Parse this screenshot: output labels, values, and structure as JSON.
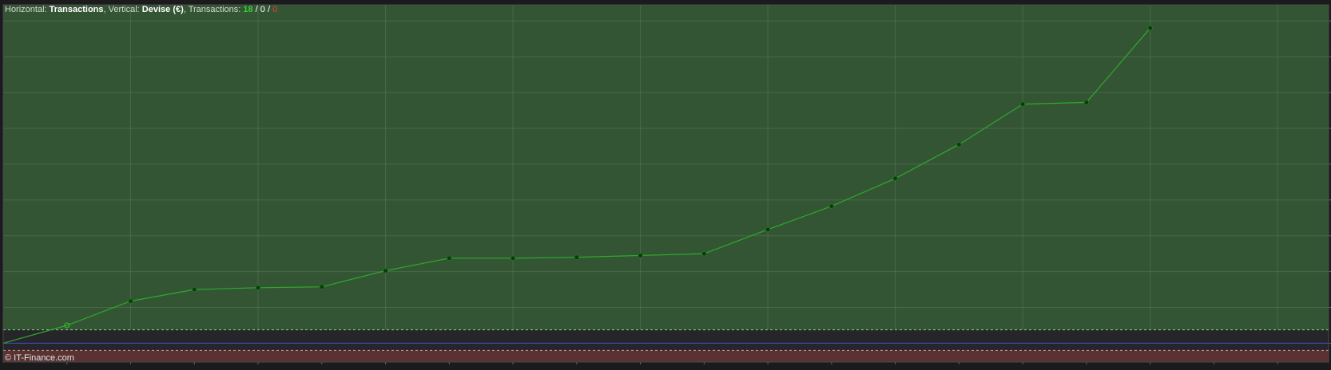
{
  "header": {
    "h_label": "Horizontal: ",
    "h_value": "Transactions",
    "v_label": ", Vertical: ",
    "v_value": "Devise (€)",
    "t_label": ", Transactions: ",
    "t_count_green": "18",
    "t_sep1": " / ",
    "t_count_white": "0",
    "t_sep2": " / ",
    "t_count_red": "0"
  },
  "footer": {
    "copyright": "© IT-Finance.com"
  },
  "colors": {
    "profit_zone": "#345534",
    "neutral_zone": "#26262a",
    "loss_zone": "#5a3232",
    "line": "#2ea82e",
    "point": "#0b3a0b",
    "zero_line": "#4b4bd2",
    "grid": "#5a7a5a"
  },
  "chart_data": {
    "type": "line",
    "title": "",
    "xlabel": "Transactions",
    "ylabel": "Devise (€)",
    "grid": true,
    "x": [
      0,
      1,
      2,
      3,
      4,
      5,
      6,
      7,
      8,
      9,
      10,
      11,
      12,
      13,
      14,
      15,
      16,
      17,
      18
    ],
    "series": [
      {
        "values": [
          0,
          1.0,
          2.35,
          3.0,
          3.1,
          3.15,
          4.05,
          4.75,
          4.75,
          4.8,
          4.9,
          5.0,
          6.35,
          7.65,
          9.2,
          11.1,
          13.35,
          13.45,
          17.6
        ]
      }
    ],
    "ylim": [
      -1.05,
      18.9
    ],
    "xlim": [
      0,
      20.8
    ]
  }
}
